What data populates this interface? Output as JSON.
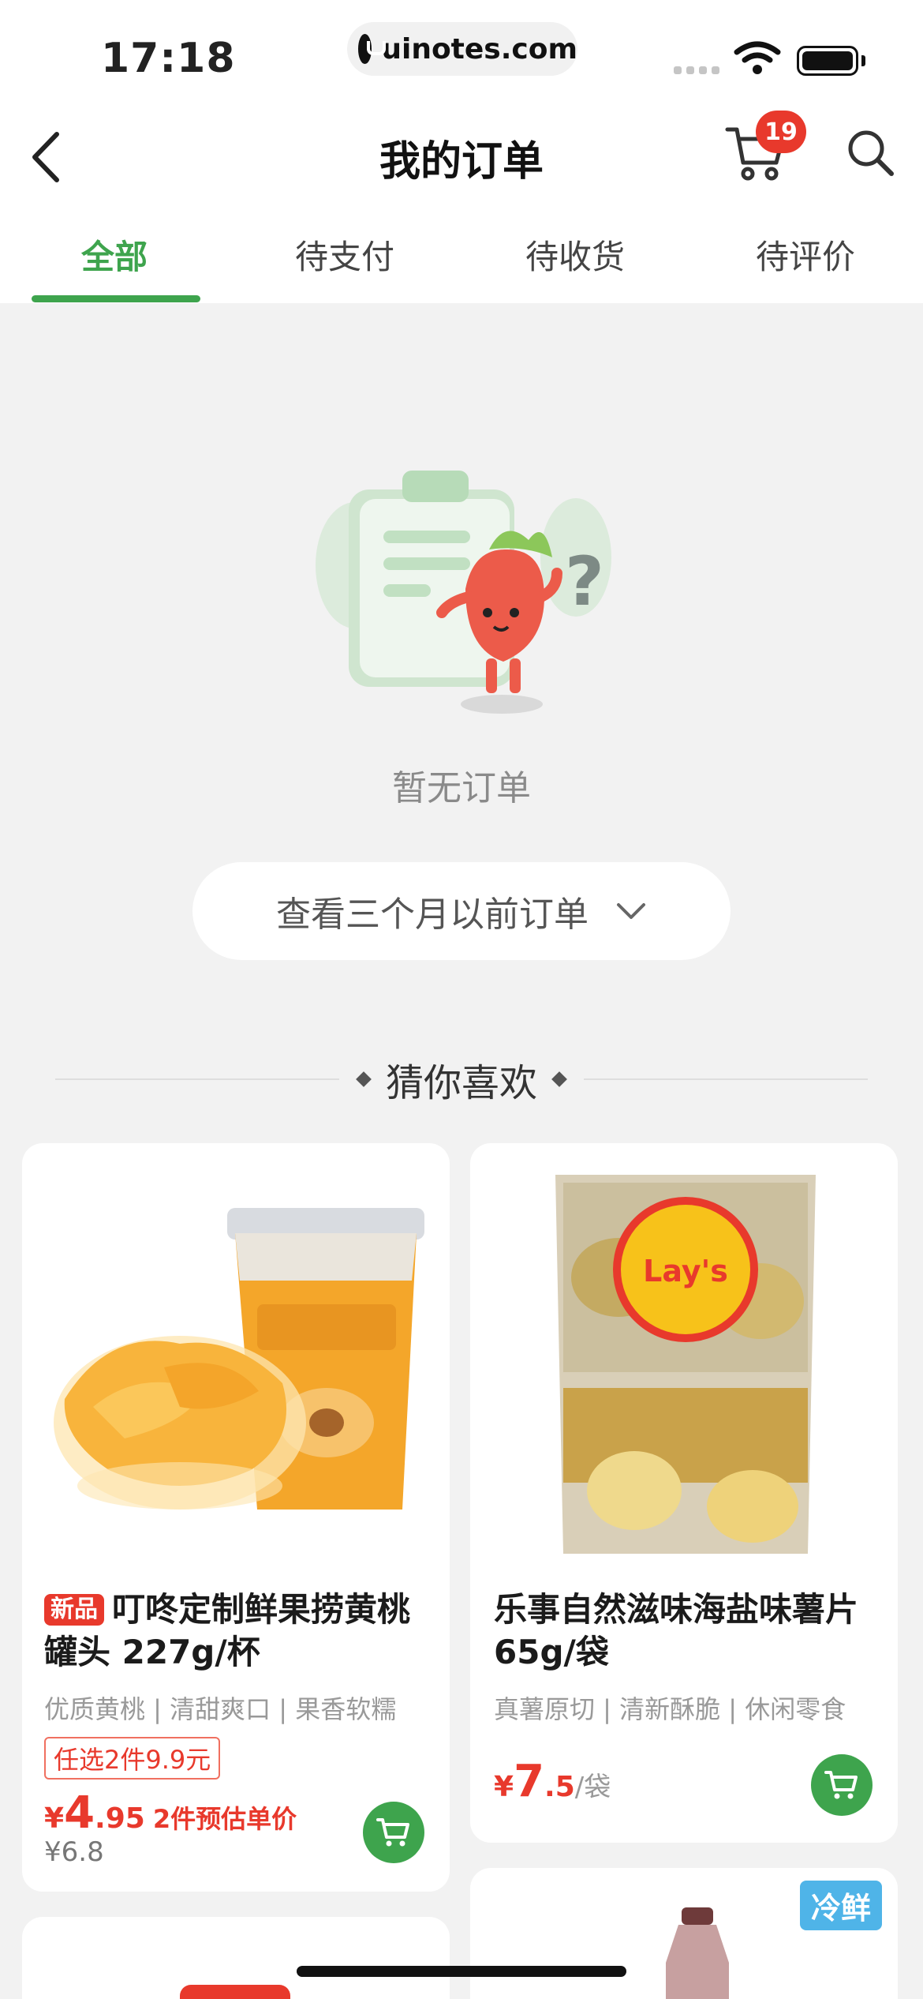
{
  "status_bar": {
    "time": "17:18",
    "url": "uinotes.com"
  },
  "header": {
    "title": "我的订单",
    "cart_badge": "19"
  },
  "tabs": [
    {
      "label": "全部",
      "active": true
    },
    {
      "label": "待支付",
      "active": false
    },
    {
      "label": "待收货",
      "active": false
    },
    {
      "label": "待评价",
      "active": false
    }
  ],
  "empty_state": {
    "message": "暂无订单",
    "history_button": "查看三个月以前订单"
  },
  "recommend": {
    "title": "猜你喜欢"
  },
  "products": [
    {
      "tag": "新品",
      "name": "叮咚定制鲜果捞黄桃罐头 227g/杯",
      "subtitle": "优质黄桃 | 清甜爽口 | 果香软糯",
      "promo": "任选2件9.9元",
      "currency": "¥",
      "price_int": "4",
      "price_dec": ".95",
      "price_note": "2件预估单价",
      "original_price": "¥6.8"
    },
    {
      "name": "乐事自然滋味海盐味薯片 65g/袋",
      "subtitle": "真薯原切 | 清新酥脆 | 休闲零食",
      "currency": "¥",
      "price_int": "7",
      "price_dec": ".5",
      "unit": "/袋"
    },
    {
      "tag": "冷鲜"
    }
  ],
  "colors": {
    "brand_green": "#3ea44d",
    "badge_red": "#e8392c",
    "chill_blue": "#4fb4e8"
  }
}
